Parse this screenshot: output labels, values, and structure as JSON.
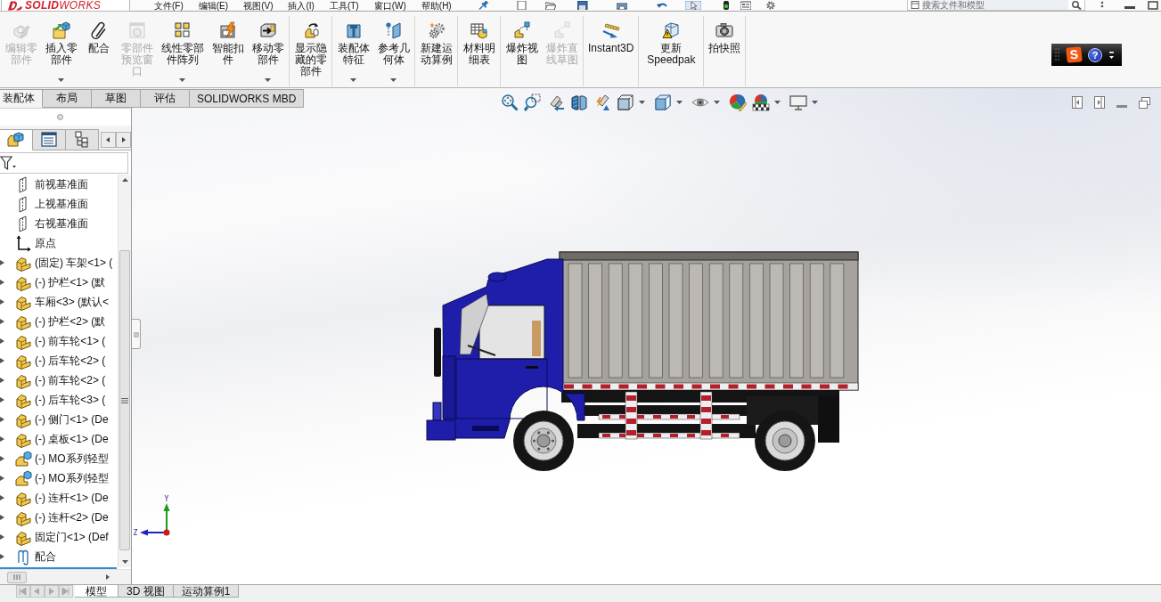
{
  "title_bar": {
    "logo": "**SOLID**WORKS",
    "menus": [
      "文件(F)",
      "编辑(E)",
      "视图(V)",
      "插入(I)",
      "工具(T)",
      "窗口(W)",
      "帮助(H)"
    ],
    "search": {
      "placeholder": "搜索文件和模型"
    }
  },
  "command_manager": {
    "groups": [
      {
        "buttons": [
          {
            "label": "编辑零部件",
            "disabled": true,
            "dropdown": false
          },
          {
            "label": "插入零部件",
            "disabled": false,
            "dropdown": true
          },
          {
            "label": "配合",
            "disabled": false,
            "dropdown": false
          },
          {
            "label": "零部件预览窗口",
            "disabled": true,
            "dropdown": false
          },
          {
            "label": "线性零部件阵列",
            "disabled": false,
            "dropdown": true
          },
          {
            "label": "智能扣件",
            "disabled": false,
            "dropdown": false
          },
          {
            "label": "移动零部件",
            "disabled": false,
            "dropdown": true
          }
        ]
      },
      {
        "buttons": [
          {
            "label": "显示隐藏的零部件",
            "disabled": false,
            "dropdown": false
          }
        ]
      },
      {
        "buttons": [
          {
            "label": "装配体特征",
            "disabled": false,
            "dropdown": true
          },
          {
            "label": "参考几何体",
            "disabled": false,
            "dropdown": true
          }
        ]
      },
      {
        "buttons": [
          {
            "label": "新建运动算例",
            "disabled": false,
            "dropdown": false
          }
        ]
      },
      {
        "buttons": [
          {
            "label": "材料明细表",
            "disabled": false,
            "dropdown": false
          }
        ]
      },
      {
        "buttons": [
          {
            "label": "爆炸视图",
            "disabled": false,
            "dropdown": false
          },
          {
            "label": "爆炸直线草图",
            "disabled": true,
            "dropdown": false
          }
        ]
      },
      {
        "buttons": [
          {
            "label": "Instant3D",
            "disabled": false,
            "dropdown": false
          }
        ]
      },
      {
        "buttons": [
          {
            "label": "更新Speedpak",
            "disabled": false,
            "dropdown": false
          }
        ]
      },
      {
        "buttons": [
          {
            "label": "拍快照",
            "disabled": false,
            "dropdown": false
          }
        ]
      }
    ]
  },
  "ime_bar": {
    "logo": "S",
    "help": "?"
  },
  "tabs": [
    {
      "label": "装配体",
      "selected": true
    },
    {
      "label": "布局",
      "selected": false
    },
    {
      "label": "草图",
      "selected": false
    },
    {
      "label": "评估",
      "selected": false
    },
    {
      "label": "SOLIDWORKS MBD",
      "selected": false
    }
  ],
  "panel": {
    "tabs": [
      {
        "selected": true
      },
      {
        "selected": false
      },
      {
        "selected": false
      }
    ],
    "tree": [
      {
        "label": "前视基准面",
        "kind": "plane"
      },
      {
        "label": "上视基准面",
        "kind": "plane"
      },
      {
        "label": "右视基准面",
        "kind": "plane"
      },
      {
        "label": "原点",
        "kind": "origin"
      },
      {
        "label": "(固定) 车架<1> (",
        "kind": "part",
        "expanded": false
      },
      {
        "label": "(-) 护栏<1> (默",
        "kind": "part",
        "expanded": false
      },
      {
        "label": "车厢<3> (默认<",
        "kind": "part",
        "expanded": false
      },
      {
        "label": "(-) 护栏<2> (默",
        "kind": "part",
        "expanded": false
      },
      {
        "label": "(-) 前车轮<1> (",
        "kind": "part",
        "expanded": false
      },
      {
        "label": "(-) 后车轮<2> (",
        "kind": "part",
        "expanded": false
      },
      {
        "label": "(-) 前车轮<2> (",
        "kind": "part",
        "expanded": false
      },
      {
        "label": "(-) 后车轮<3> (",
        "kind": "part",
        "expanded": false
      },
      {
        "label": "(-) 侧门<1> (De",
        "kind": "part",
        "expanded": false
      },
      {
        "label": "(-) 桌板<1> (De",
        "kind": "part",
        "expanded": false
      },
      {
        "label": "(-) MO系列轻型",
        "kind": "assembly",
        "expanded": false
      },
      {
        "label": "(-) MO系列轻型",
        "kind": "assembly",
        "expanded": false
      },
      {
        "label": "(-) 连杆<1> (De",
        "kind": "part",
        "expanded": false
      },
      {
        "label": "(-) 连杆<2> (De",
        "kind": "part",
        "expanded": false
      },
      {
        "label": "固定门<1> (Def",
        "kind": "part",
        "expanded": false
      },
      {
        "label": "配合",
        "kind": "mates",
        "expanded": false
      }
    ]
  },
  "viewport": {
    "triad": {
      "y_label": "Y",
      "z_label": "Z"
    }
  },
  "bottom_tabs": [
    {
      "label": "模型",
      "selected": true
    },
    {
      "label": "3D 视图",
      "selected": false
    },
    {
      "label": "运动算例1",
      "selected": false
    }
  ]
}
